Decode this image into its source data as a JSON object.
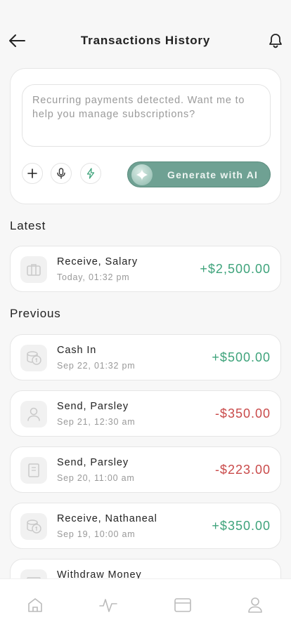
{
  "header": {
    "title": "Transactions History",
    "back_icon": "arrow-left-icon",
    "notification_icon": "bell-icon"
  },
  "ai_panel": {
    "prompt_placeholder": "Recurring payments detected. Want me to help you manage subscriptions?",
    "actions": [
      "plus-icon",
      "microphone-icon",
      "lightning-icon"
    ],
    "generate_label": "Generate with AI"
  },
  "sections": {
    "latest_label": "Latest",
    "previous_label": "Previous"
  },
  "latest": [
    {
      "title": "Receive, Salary",
      "time": "Today, 01:32 pm",
      "amount": "+$2,500.00",
      "icon": "briefcase-icon"
    }
  ],
  "previous": [
    {
      "title": "Cash In",
      "time": "Sep 22, 01:32 pm",
      "amount": "+$500.00",
      "icon": "coins-icon"
    },
    {
      "title": "Send, Parsley",
      "time": "Sep 21, 12:30 am",
      "amount": "-$350.00",
      "icon": "user-icon"
    },
    {
      "title": "Send, Parsley",
      "time": "Sep 20, 11:00 am",
      "amount": "-$223.00",
      "icon": "document-icon"
    },
    {
      "title": "Receive, Nathaneal",
      "time": "Sep 19, 10:00 am",
      "amount": "+$350.00",
      "icon": "coins-icon"
    },
    {
      "title": "Withdraw Money",
      "time": "",
      "amount": "",
      "icon": "atm-icon"
    }
  ],
  "bottom_nav": [
    "home-icon",
    "activity-icon",
    "card-icon",
    "profile-icon"
  ],
  "colors": {
    "positive": "#3ea37b",
    "negative": "#c94a4a",
    "accent": "#6fa193"
  }
}
